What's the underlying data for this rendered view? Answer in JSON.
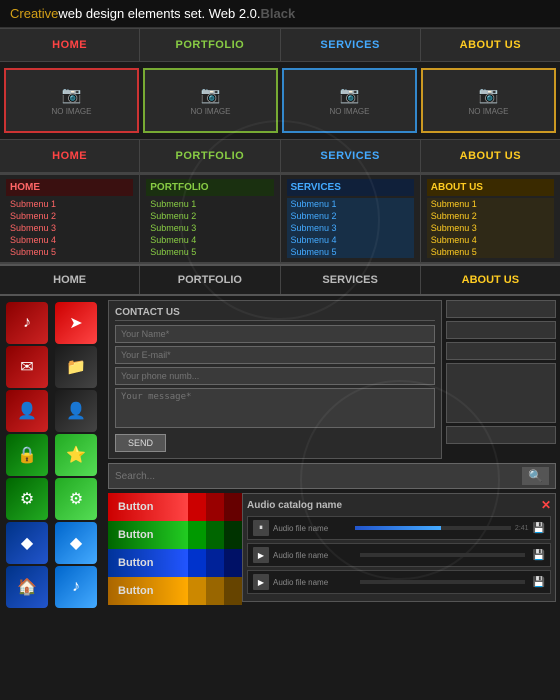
{
  "title": {
    "prefix": "Creative",
    "middle": " web design elements set. Web 2.0. ",
    "suffix": "Black"
  },
  "nav1": {
    "items": [
      "HOME",
      "PORTFOLIO",
      "SERVICES",
      "ABOUT US"
    ],
    "colors": [
      "red",
      "green",
      "blue",
      "yellow"
    ]
  },
  "images": {
    "label": "NO IMAGE",
    "colors": [
      "red",
      "green",
      "blue",
      "yellow"
    ]
  },
  "nav2": {
    "items": [
      "HOME",
      "PORTFOLIO",
      "SERVICES",
      "ABOUT US"
    ]
  },
  "submenu": {
    "columns": [
      {
        "header": "HOME",
        "color": "red",
        "items": [
          "Submenu 1",
          "Submenu 2",
          "Submenu 3",
          "Submenu 4",
          "Submenu 5"
        ]
      },
      {
        "header": "PORTFOLIO",
        "color": "green",
        "items": [
          "Submenu 1",
          "Submenu 2",
          "Submenu 3",
          "Submenu 4",
          "Submenu 5"
        ]
      },
      {
        "header": "SERVICES",
        "color": "blue",
        "items": [
          "Submenu 1",
          "Submenu 2",
          "Submenu 3",
          "Submenu 4",
          "Submenu 5"
        ]
      },
      {
        "header": "ABOUT US",
        "color": "yellow",
        "items": [
          "Submenu 1",
          "Submenu 2",
          "Submenu 3",
          "Submenu 4",
          "Submenu 5"
        ]
      }
    ]
  },
  "nav3": {
    "items": [
      "HOME",
      "PORTFOLIO",
      "SERVICES",
      "ABOUT US"
    ]
  },
  "contact": {
    "title": "CONTACT US",
    "fields": {
      "name": "Your Name*",
      "email": "Your E-mail*",
      "phone": "Your phone numb...",
      "message": "Your message*"
    },
    "send_button": "SEND"
  },
  "search": {
    "placeholder": "Search..."
  },
  "buttons": [
    {
      "label": "Button",
      "color": "red"
    },
    {
      "label": "Button",
      "color": "green"
    },
    {
      "label": "Button",
      "color": "blue"
    },
    {
      "label": "Button",
      "color": "yellow"
    }
  ],
  "audio": {
    "title": "Audio catalog name",
    "tracks": [
      {
        "name": "Audio file name",
        "time": "2:41"
      },
      {
        "name": "Audio file name",
        "time": ""
      },
      {
        "name": "Audio file name",
        "time": ""
      }
    ]
  },
  "icons": {
    "camera": "📷",
    "search": "🔍",
    "home": "🏠",
    "user": "👤",
    "lock": "🔒",
    "star": "⭐",
    "settings": "⚙",
    "mail": "✉",
    "folder": "📁",
    "music": "♪",
    "diamond": "◆",
    "arrow": "➤"
  }
}
